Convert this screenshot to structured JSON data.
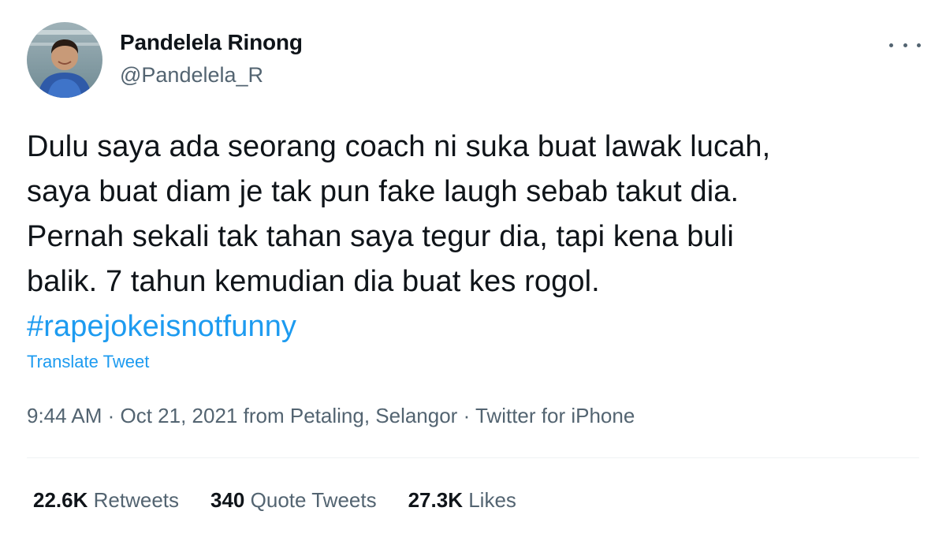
{
  "user": {
    "display_name": "Pandelela Rinong",
    "handle": "@Pandelela_R"
  },
  "tweet": {
    "lines": [
      "Dulu saya ada seorang coach ni suka buat lawak lucah,",
      "saya buat diam je tak pun fake laugh sebab takut dia.",
      "Pernah sekali tak tahan saya tegur dia, tapi kena buli",
      "balik. 7 tahun kemudian dia buat kes rogol."
    ],
    "hashtag": "#rapejokeisnotfunny",
    "translate_label": "Translate Tweet"
  },
  "meta": {
    "time": "9:44 AM",
    "sep1": " · ",
    "date": "Oct 21, 2021",
    "from_label": " from ",
    "location": "Petaling, Selangor",
    "sep2": " · ",
    "source": "Twitter for iPhone"
  },
  "stats": {
    "retweets_count": "22.6K",
    "retweets_label": "Retweets",
    "quotes_count": "340",
    "quotes_label": "Quote Tweets",
    "likes_count": "27.3K",
    "likes_label": "Likes"
  },
  "icons": {
    "more": "more-horizontal-icon"
  },
  "colors": {
    "link": "#1d9bf0",
    "secondary_text": "#536471",
    "primary_text": "#0f1419",
    "divider": "#eff3f4"
  }
}
